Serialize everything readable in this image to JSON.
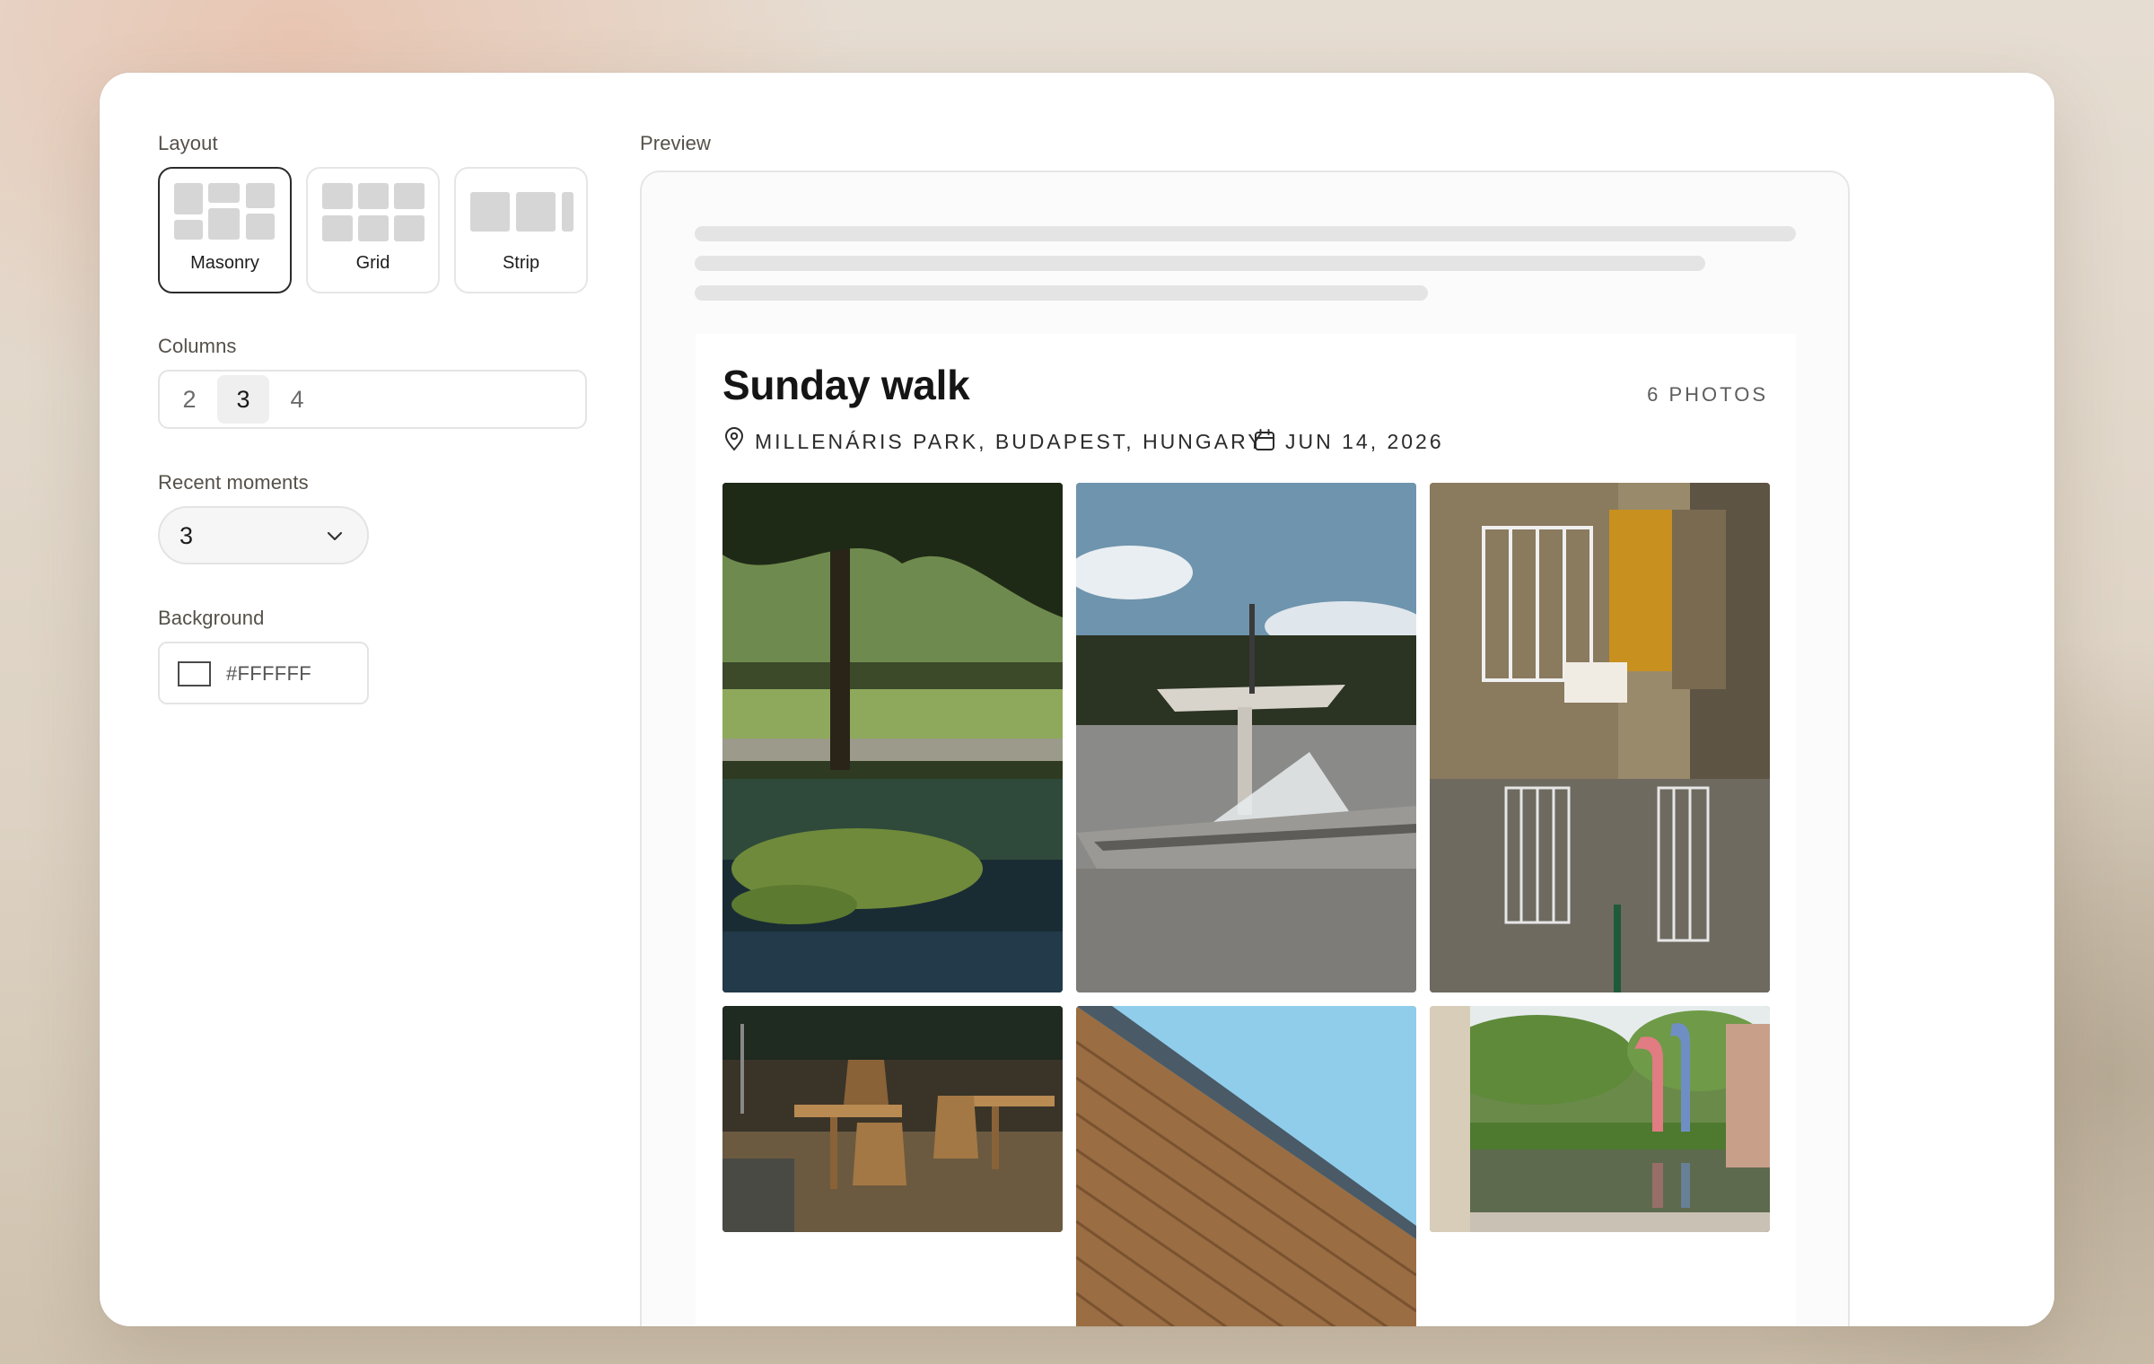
{
  "controls": {
    "layout": {
      "label": "Layout",
      "options": [
        {
          "label": "Masonry",
          "icon": "masonry-layout-icon",
          "selected": true
        },
        {
          "label": "Grid",
          "icon": "grid-layout-icon",
          "selected": false
        },
        {
          "label": "Strip",
          "icon": "strip-layout-icon",
          "selected": false
        }
      ]
    },
    "columns": {
      "label": "Columns",
      "options": [
        "2",
        "3",
        "4"
      ],
      "selected": "3"
    },
    "recent_moments": {
      "label": "Recent moments",
      "value": "3",
      "icon": "chevron-down-icon"
    },
    "background": {
      "label": "Background",
      "value": "#FFFFFF",
      "swatch_color": "#FFFFFF"
    }
  },
  "preview": {
    "label": "Preview",
    "card": {
      "title": "Sunday walk",
      "photo_count": "6 PHOTOS",
      "location": "MILLENÁRIS PARK, BUDAPEST, HUNGARY",
      "location_icon": "map-pin-icon",
      "date": "JUN 14, 2026",
      "date_icon": "calendar-icon",
      "photos": [
        {
          "subject": "pond-with-willow-tree"
        },
        {
          "subject": "fountain-canopy-sculpture"
        },
        {
          "subject": "building-corner-with-yellow-window"
        },
        {
          "subject": "cafe-tables-and-chairs"
        },
        {
          "subject": "wooden-slat-facade-and-sky"
        },
        {
          "subject": "colored-pipes-by-pond"
        }
      ]
    }
  },
  "colors": {
    "selected_border": "#2b2b2b",
    "skeleton": "#e4e4e4",
    "text_primary": "#151515"
  }
}
